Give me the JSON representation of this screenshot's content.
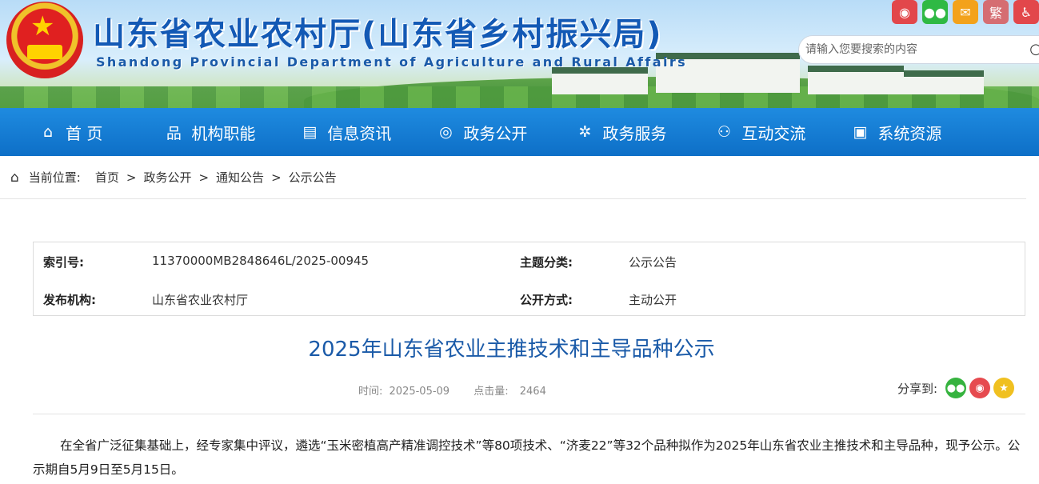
{
  "header": {
    "title": "山东省农业农村厅(山东省乡村振兴局)",
    "subtitle": "Shandong Provincial Department of Agriculture and Rural Affairs",
    "social": [
      "weibo-icon",
      "wechat-icon",
      "mail-icon",
      "繁",
      "more-icon"
    ],
    "search_placeholder": "请输入您要搜索的内容"
  },
  "nav": [
    {
      "label": "首 页",
      "icon": "⌂"
    },
    {
      "label": "机构职能",
      "icon": "品"
    },
    {
      "label": "信息资讯",
      "icon": "▤"
    },
    {
      "label": "政务公开",
      "icon": "◎"
    },
    {
      "label": "政务服务",
      "icon": "✲"
    },
    {
      "label": "互动交流",
      "icon": "⚇"
    },
    {
      "label": "系统资源",
      "icon": "▣"
    }
  ],
  "breadcrumb": {
    "label": "当前位置:",
    "items": [
      "首页",
      "政务公开",
      "通知公告",
      "公示公告"
    ],
    "sep": ">"
  },
  "meta": {
    "index_key": "索引号:",
    "index_val": "11370000MB2848646L/2025-00945",
    "topic_key": "主题分类:",
    "topic_val": "公示公告",
    "org_key": "发布机构:",
    "org_val": "山东省农业农村厅",
    "mode_key": "公开方式:",
    "mode_val": "主动公开"
  },
  "article": {
    "title": "2025年山东省农业主推技术和主导品种公示",
    "time_label": "时间:",
    "time": "2025-05-09",
    "hits_label": "点击量:",
    "hits": "2464",
    "share_label": "分享到:",
    "body": "在全省广泛征集基础上，经专家集中评议，遴选“玉米密植高产精准调控技术”等80项技术、“济麦22”等32个品种拟作为2025年山东省农业主推技术和主导品种，现予公示。公示期自5月9日至5月15日。"
  }
}
